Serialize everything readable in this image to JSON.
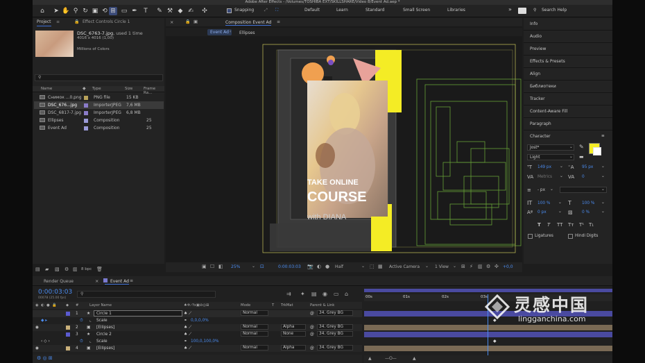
{
  "titlebar": {
    "title": "Adobe After Effects - /Volumes/TOSHIBA EXT/SKILLSHARE/Video 8/Event Ad.aep *"
  },
  "toolbar": {
    "snapping_label": "Snapping",
    "workspaces": [
      "Default",
      "Learn",
      "Standard",
      "Small Screen",
      "Libraries"
    ],
    "search_placeholder": "Search Help"
  },
  "project_panel": {
    "tab_project": "Project",
    "tab_effect_controls": "Effect Controls Circle 1",
    "preview": {
      "filename": "DSC_6763-7.jpg",
      "used": ", used 1 time",
      "dims": "4016 x 4016 (1,00)",
      "colors": "Millions of Colors"
    },
    "columns": [
      "Name",
      "Type",
      "Size",
      "Frame Ra..."
    ],
    "bpc": "8 bpc",
    "rows": [
      {
        "name": "Снимок ...0.png",
        "type": "PNG file",
        "size": "15 KB",
        "fps": ""
      },
      {
        "name": "DSC_676...jpg",
        "type": "ImporterJPEG",
        "size": "7,6 MB",
        "fps": ""
      },
      {
        "name": "DSC_6817-7.jpg",
        "type": "ImporterJPEG",
        "size": "6,8 MB",
        "fps": ""
      },
      {
        "name": "Ellipses",
        "type": "Composition",
        "size": "",
        "fps": "25"
      },
      {
        "name": "Event Ad",
        "type": "Composition",
        "size": "",
        "fps": "25"
      }
    ]
  },
  "composition": {
    "panel_title": "Composition Event Ad",
    "tabs": [
      "Event Ad",
      "Ellipses"
    ],
    "poster_line1": "TAKE ONLINE",
    "poster_line2": "COURSE",
    "poster_line3": "with DIANA",
    "zoom": "25%",
    "timecode": "0:00:03:03",
    "resolution": "Half",
    "camera": "Active Camera",
    "view": "1 View",
    "exposure": "+0,0",
    "colors": {
      "yellow": "#f4ec25",
      "orange": "#f0a050",
      "pink": "#e8a29a",
      "purple": "#7a4fc0"
    }
  },
  "right_panel": {
    "items": [
      "Info",
      "Audio",
      "Preview",
      "Effects & Presets",
      "Align",
      "Библиотеки",
      "Tracker",
      "Content-Aware Fill",
      "Paragraph"
    ],
    "character": {
      "title": "Character",
      "font": "Jost*",
      "style": "Light",
      "size": "149 px",
      "leading": "95 px",
      "kerning": "Metrics",
      "tracking": "0",
      "stroke": "- px",
      "vscale": "100 %",
      "hscale": "100 %",
      "baseline": "0 px",
      "tsume": "0 %",
      "styles": [
        "T",
        "T",
        "TT",
        "Tт",
        "T¹",
        "T₁"
      ],
      "ligatures": "Ligatures",
      "hindi": "Hindi Digits",
      "fill_color": "#f4ec25"
    }
  },
  "timeline": {
    "tab_render": "Render Queue",
    "tab_comp": "Event Ad",
    "timecode": "0:00:03:03",
    "frame_info": "00078 (25.00 fps)",
    "col_layer_name": "Layer Name",
    "col_mode": "Mode",
    "col_t": "T",
    "col_trkmat": "TrkMat",
    "col_parent": "Parent & Link",
    "ruler": [
      "00s",
      "01s",
      "02s",
      "03s"
    ],
    "rows": [
      {
        "num": "1",
        "name": "Circle 1",
        "mode": "Normal",
        "trkmat": "",
        "parent": "34. Grey BG",
        "type": "layer",
        "bar": "#4a4aa0"
      },
      {
        "num": "",
        "name": "Scale",
        "value": "0,0,0,0%",
        "type": "prop"
      },
      {
        "num": "2",
        "name": "[Ellipses]",
        "mode": "Normal",
        "trkmat": "Alpha",
        "parent": "34. Grey BG",
        "type": "layer",
        "bar": "#7a6a55"
      },
      {
        "num": "3",
        "name": "Circle 2",
        "mode": "Normal",
        "trkmat": "None",
        "parent": "34. Grey BG",
        "type": "layer",
        "bar": "#4a4aa0"
      },
      {
        "num": "",
        "name": "Scale",
        "value": "100,0,100,0%",
        "type": "prop"
      },
      {
        "num": "4",
        "name": "[Ellipses]",
        "mode": "Normal",
        "trkmat": "Alpha",
        "parent": "34. Grey BG",
        "type": "layer",
        "bar": "#7a6a55"
      }
    ]
  },
  "watermark": {
    "cn_text": "灵感中国",
    "url": "lingganchina.com"
  }
}
